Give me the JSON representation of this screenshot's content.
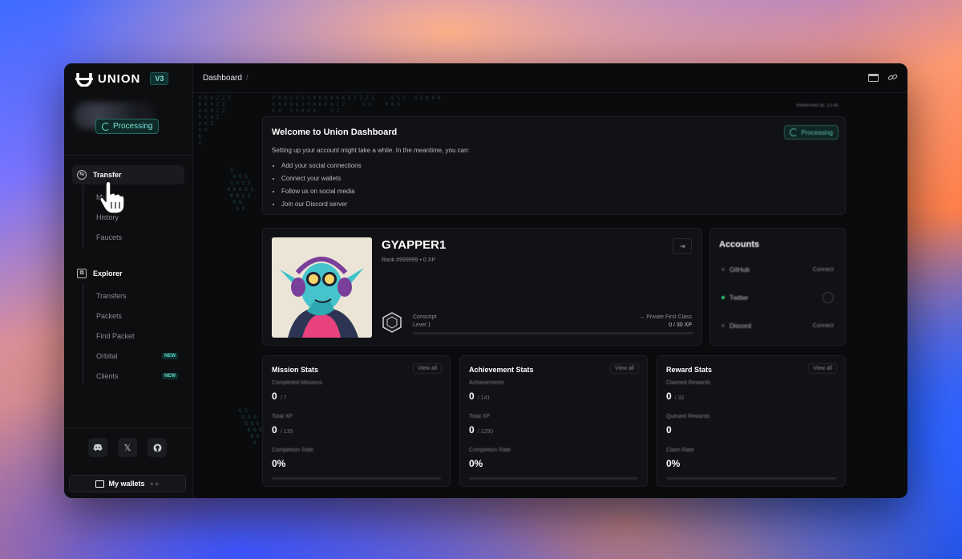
{
  "brand": {
    "name": "UNION",
    "version": "V3"
  },
  "sidebar": {
    "status_badge": "Processing",
    "transfer": {
      "label": "Transfer",
      "items": [
        {
          "label": "Multisig"
        },
        {
          "label": "History"
        },
        {
          "label": "Faucets"
        }
      ]
    },
    "explorer": {
      "label": "Explorer",
      "items": [
        {
          "label": "Transfers"
        },
        {
          "label": "Packets"
        },
        {
          "label": "Find Packet"
        },
        {
          "label": "Orbital",
          "badge": "NEW"
        },
        {
          "label": "Clients",
          "badge": "NEW"
        }
      ]
    },
    "social_icons": [
      "discord-icon",
      "x-icon",
      "github-icon"
    ],
    "wallets_label": "My wallets"
  },
  "topbar": {
    "breadcrumb": "Dashboard",
    "separator": "/"
  },
  "refreshed": "Refreshed at: 23:40",
  "welcome": {
    "title": "Welcome to Union Dashboard",
    "subtitle": "Setting up your account might take a while. In the meantime, you can:",
    "items": [
      "Add your social connections",
      "Connect your wallets",
      "Follow us on social media",
      "Join our Discord server"
    ],
    "status": "Processing"
  },
  "profile": {
    "username": "GYAPPER1",
    "rank": "Rank #999999 • 0 XP",
    "level_name": "Conscript",
    "level": "Level 1",
    "next_level": "→ Private First Class",
    "xp_progress": "0 / 30 XP",
    "xp_fraction": 0
  },
  "accounts": {
    "title": "Accounts",
    "rows": [
      {
        "name": "GitHub",
        "action": "Connect",
        "connected": false
      },
      {
        "name": "Twitter",
        "action": "",
        "connected": true
      },
      {
        "name": "Discord",
        "action": "Connect",
        "connected": false
      }
    ]
  },
  "mission_stats": {
    "title": "Mission Stats",
    "view_all": "View all",
    "completed_label": "Completed Missions",
    "completed": "0",
    "completed_total": "/ 7",
    "xp_label": "Total XP",
    "xp": "0",
    "xp_total": "/ 135",
    "rate_label": "Completion Rate",
    "rate": "0%"
  },
  "achievement_stats": {
    "title": "Achievement Stats",
    "view_all": "View all",
    "achievements_label": "Achievements",
    "achievements": "0",
    "achievements_total": "/ 141",
    "xp_label": "Total XP",
    "xp": "0",
    "xp_total": "/ 1290",
    "rate_label": "Completion Rate",
    "rate": "0%"
  },
  "reward_stats": {
    "title": "Reward Stats",
    "view_all": "View all",
    "claimed_label": "Claimed Rewards",
    "claimed": "0",
    "claimed_total": "/ 32",
    "queued_label": "Queued Rewards",
    "queued": "0",
    "rate_label": "Claim Rate",
    "rate": "0%"
  },
  "colors": {
    "accent": "#7ce3d7",
    "window_bg": "#0a0b0d",
    "card_bg": "#111215",
    "online": "#33d37a"
  }
}
